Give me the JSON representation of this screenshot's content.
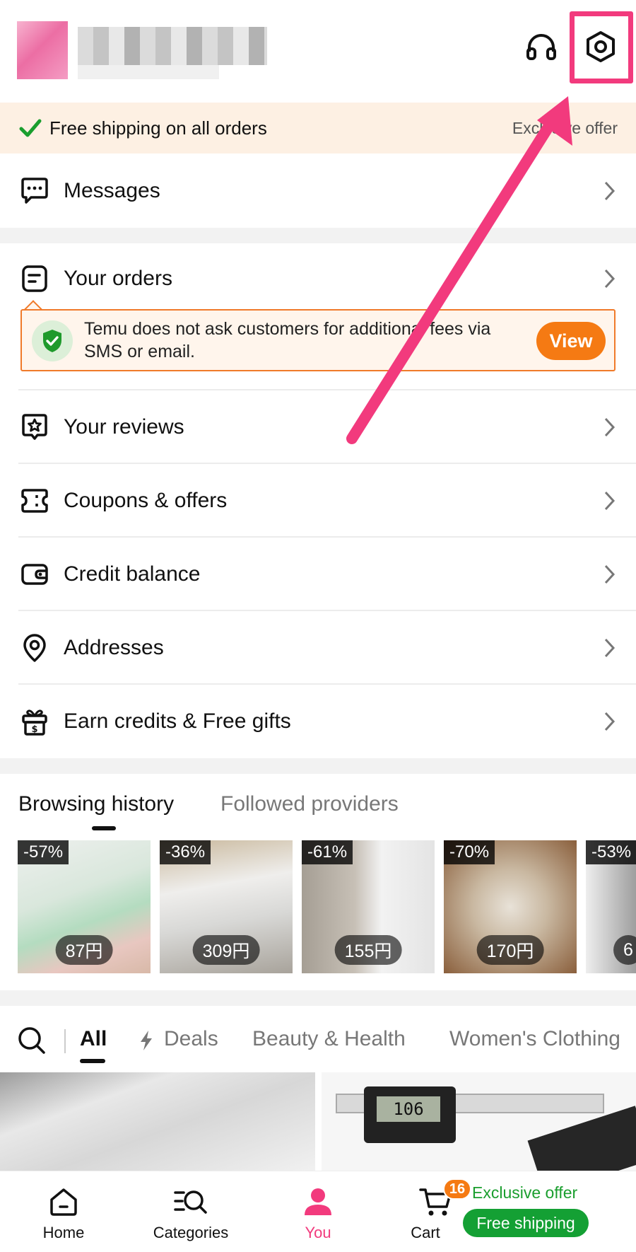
{
  "header": {
    "support_icon": "headphones-icon",
    "settings_icon": "settings-hexagon-icon"
  },
  "promo": {
    "text": "Free shipping on all orders",
    "right": "Exclusive offer"
  },
  "menu": {
    "messages": "Messages",
    "orders": "Your orders",
    "reviews": "Your reviews",
    "coupons": "Coupons & offers",
    "credit": "Credit balance",
    "addresses": "Addresses",
    "earn": "Earn credits & Free gifts"
  },
  "alert": {
    "message": "Temu does not ask customers for additional fees via SMS or email.",
    "button": "View"
  },
  "browsing": {
    "tab_history": "Browsing history",
    "tab_providers": "Followed providers",
    "products": [
      {
        "discount": "-57%",
        "price": "87円"
      },
      {
        "discount": "-36%",
        "price": "309円"
      },
      {
        "discount": "-61%",
        "price": "155円"
      },
      {
        "discount": "-70%",
        "price": "170円"
      },
      {
        "discount": "-53%",
        "price": "6"
      }
    ]
  },
  "categories": {
    "all": "All",
    "deals": "Deals",
    "beauty": "Beauty & Health",
    "womens": "Women's Clothing"
  },
  "feed": {
    "caliper_reading": "106"
  },
  "bottom_nav": {
    "home": "Home",
    "categories": "Categories",
    "you": "You",
    "cart": "Cart",
    "cart_count": "16",
    "exclusive": "Exclusive offer",
    "free_shipping": "Free shipping"
  },
  "colors": {
    "accent_pink": "#f23a7d",
    "orange": "#f57a13",
    "green": "#14a034"
  }
}
